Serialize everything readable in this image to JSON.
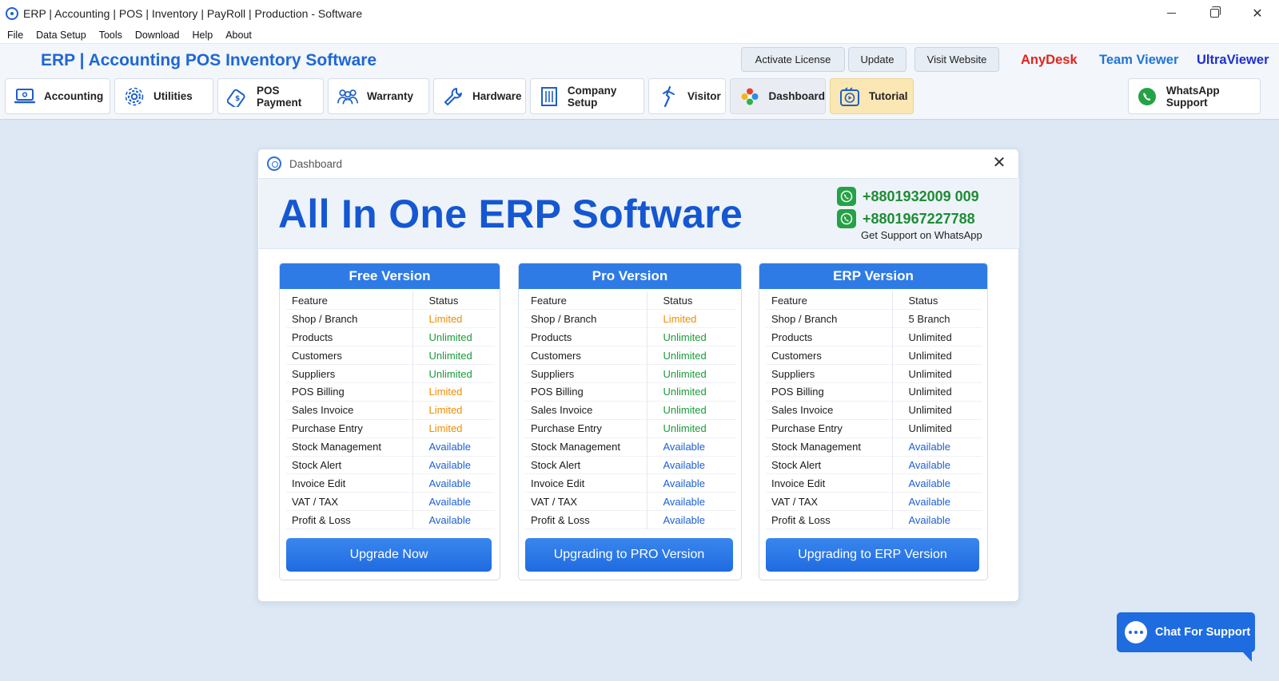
{
  "window": {
    "title": "ERP | Accounting | POS | Inventory | PayRoll | Production - Software",
    "controls": [
      "minimize",
      "maximize",
      "close"
    ]
  },
  "menu": [
    "File",
    "Data Setup",
    "Tools",
    "Download",
    "Help",
    "About"
  ],
  "header": {
    "brand": "ERP | Accounting POS Inventory Software",
    "buttons": [
      "Activate License",
      "Update",
      "Visit Website"
    ],
    "links": [
      {
        "label": "AnyDesk",
        "color": "#e0241c"
      },
      {
        "label": "Team Viewer",
        "color": "#1f74d6"
      },
      {
        "label": "UltraViewer",
        "color": "#1d2fd0"
      }
    ]
  },
  "nav": {
    "tabs": [
      {
        "label": "Accounting",
        "icon": "laptop-icon"
      },
      {
        "label": "Utilities",
        "icon": "gear-icon"
      },
      {
        "label": "POS Payment",
        "icon": "card-payment-icon"
      },
      {
        "label": "Warranty",
        "icon": "users-icon"
      },
      {
        "label": "Hardware",
        "icon": "wrench-icon"
      },
      {
        "label": "Company Setup",
        "icon": "building-icon"
      },
      {
        "label": "Visitor",
        "icon": "visitor-icon"
      },
      {
        "label": "Dashboard",
        "icon": "colorful-flower-icon"
      },
      {
        "label": "Tutorial",
        "icon": "video-play-icon"
      }
    ],
    "whatsapp": "WhatsApp Support"
  },
  "dialog": {
    "title": "Dashboard",
    "headline": "All In One ERP Software",
    "phones": [
      "+8801932009 009",
      "+8801967227788"
    ],
    "support_note": "Get Support on WhatsApp",
    "columns": {
      "feature": "Feature",
      "status": "Status"
    },
    "plans": [
      {
        "name": "Free Version",
        "button": "Upgrade Now",
        "rows": [
          {
            "feature": "Shop / Branch",
            "status": "Limited",
            "kind": "limited"
          },
          {
            "feature": "Products",
            "status": "Unlimited",
            "kind": "unlimited"
          },
          {
            "feature": "Customers",
            "status": "Unlimited",
            "kind": "unlimited"
          },
          {
            "feature": "Suppliers",
            "status": "Unlimited",
            "kind": "unlimited"
          },
          {
            "feature": "POS Billing",
            "status": "Limited",
            "kind": "limited"
          },
          {
            "feature": "Sales Invoice",
            "status": "Limited",
            "kind": "limited"
          },
          {
            "feature": "Purchase Entry",
            "status": "Limited",
            "kind": "limited"
          },
          {
            "feature": "Stock Management",
            "status": "Available",
            "kind": "available"
          },
          {
            "feature": "Stock Alert",
            "status": "Available",
            "kind": "available"
          },
          {
            "feature": "Invoice Edit",
            "status": "Available",
            "kind": "available"
          },
          {
            "feature": "VAT / TAX",
            "status": "Available",
            "kind": "available"
          },
          {
            "feature": "Profit & Loss",
            "status": "Available",
            "kind": "available"
          }
        ]
      },
      {
        "name": "Pro Version",
        "button": "Upgrading to PRO Version",
        "rows": [
          {
            "feature": "Shop / Branch",
            "status": "Limited",
            "kind": "limited"
          },
          {
            "feature": "Products",
            "status": "Unlimited",
            "kind": "unlimited"
          },
          {
            "feature": "Customers",
            "status": "Unlimited",
            "kind": "unlimited"
          },
          {
            "feature": "Suppliers",
            "status": "Unlimited",
            "kind": "unlimited"
          },
          {
            "feature": "POS Billing",
            "status": "Unlimited",
            "kind": "unlimited"
          },
          {
            "feature": "Sales Invoice",
            "status": "Unlimited",
            "kind": "unlimited"
          },
          {
            "feature": "Purchase Entry",
            "status": "Unlimited",
            "kind": "unlimited"
          },
          {
            "feature": "Stock Management",
            "status": "Available",
            "kind": "available"
          },
          {
            "feature": "Stock Alert",
            "status": "Available",
            "kind": "available"
          },
          {
            "feature": "Invoice Edit",
            "status": "Available",
            "kind": "available"
          },
          {
            "feature": "VAT / TAX",
            "status": "Available",
            "kind": "available"
          },
          {
            "feature": "Profit & Loss",
            "status": "Available",
            "kind": "available"
          }
        ]
      },
      {
        "name": "ERP Version",
        "button": "Upgrading to ERP Version",
        "rows": [
          {
            "feature": "Shop / Branch",
            "status": "5 Branch",
            "kind": "plain"
          },
          {
            "feature": "Products",
            "status": "Unlimited",
            "kind": "plain"
          },
          {
            "feature": "Customers",
            "status": "Unlimited",
            "kind": "plain"
          },
          {
            "feature": "Suppliers",
            "status": "Unlimited",
            "kind": "plain"
          },
          {
            "feature": "POS Billing",
            "status": "Unlimited",
            "kind": "plain"
          },
          {
            "feature": "Sales Invoice",
            "status": "Unlimited",
            "kind": "plain"
          },
          {
            "feature": "Purchase Entry",
            "status": "Unlimited",
            "kind": "plain"
          },
          {
            "feature": "Stock Management",
            "status": "Available",
            "kind": "available"
          },
          {
            "feature": "Stock Alert",
            "status": "Available",
            "kind": "available"
          },
          {
            "feature": "Invoice Edit",
            "status": "Available",
            "kind": "available"
          },
          {
            "feature": "VAT / TAX",
            "status": "Available",
            "kind": "available"
          },
          {
            "feature": "Profit & Loss",
            "status": "Available",
            "kind": "available"
          }
        ]
      }
    ]
  },
  "chat": {
    "label": "Chat For Support"
  },
  "colors": {
    "brand_blue": "#1e67d6",
    "headline_blue": "#1457d1",
    "plan_header": "#2f7be6",
    "limited": "#f08c00",
    "unlimited": "#1a9a3a",
    "available": "#1d5fd6",
    "whatsapp_green": "#25a245"
  }
}
